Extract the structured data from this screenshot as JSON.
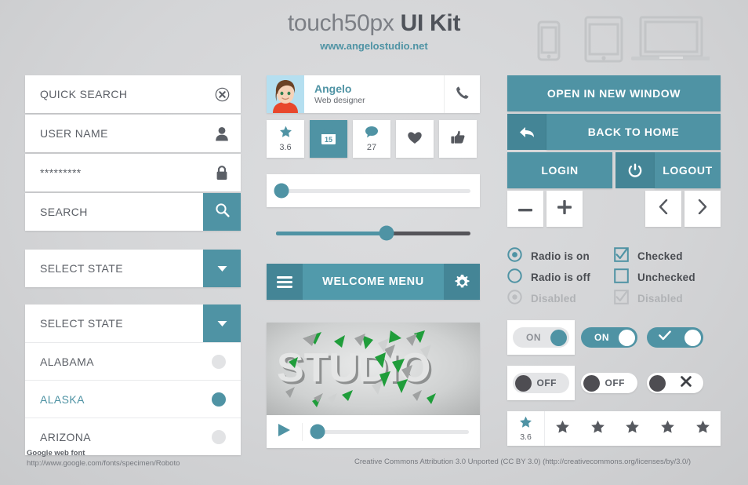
{
  "header": {
    "title_light": "touch50px ",
    "title_bold": "UI Kit",
    "subtitle": "www.angelostudio.net",
    "devices": [
      "phone-icon",
      "tablet-icon",
      "laptop-icon"
    ]
  },
  "left": {
    "quick_search": {
      "label": "QUICK SEARCH",
      "icon": "clear-circle-icon"
    },
    "user_name": {
      "label": "USER NAME",
      "icon": "user-icon"
    },
    "password": {
      "value": "*********",
      "icon": "lock-icon"
    },
    "search": {
      "label": "SEARCH",
      "icon": "search-icon"
    },
    "select_closed": {
      "label": "SELECT STATE",
      "icon": "chevron-down-icon"
    },
    "select_open": {
      "label": "SELECT STATE",
      "icon": "chevron-down-icon",
      "options": [
        {
          "label": "ALABAMA",
          "selected": false
        },
        {
          "label": "ALASKA",
          "selected": true
        },
        {
          "label": "ARIZONA",
          "selected": false
        }
      ]
    }
  },
  "middle": {
    "contact": {
      "name": "Angelo",
      "role": "Web designer",
      "avatar": "avatar",
      "phone_icon": "phone-icon"
    },
    "icon_buttons": [
      {
        "icon": "star-icon",
        "value": "3.6",
        "active": false
      },
      {
        "icon": "calendar-icon",
        "value": "15",
        "active": true
      },
      {
        "icon": "comment-icon",
        "value": "27",
        "active": false
      },
      {
        "icon": "heart-icon",
        "value": "",
        "active": false
      },
      {
        "icon": "thumbs-up-icon",
        "value": "",
        "active": false
      }
    ],
    "slider_card": {
      "value_pct": 3
    },
    "slider_bare": {
      "value_pct": 57
    },
    "menu": {
      "title": "WELCOME MENU",
      "left_icon": "hamburger-icon",
      "right_icon": "gear-icon"
    },
    "video": {
      "poster_text": "STUDIO",
      "play_icon": "play-icon",
      "progress_pct": 4
    }
  },
  "right": {
    "open_new_window": "OPEN IN NEW WINDOW",
    "back_to_home": {
      "label": "BACK TO HOME",
      "icon": "back-arrow-icon"
    },
    "login": "LOGIN",
    "logout": {
      "label": "LOGOUT",
      "icon": "power-icon"
    },
    "stepper": [
      {
        "icon": "minus-icon"
      },
      {
        "icon": "plus-icon"
      }
    ],
    "pager": [
      {
        "icon": "chevron-left-icon"
      },
      {
        "icon": "chevron-right-icon"
      }
    ],
    "choices": [
      {
        "type": "radio",
        "state": "on",
        "label": "Radio is on",
        "disabled": false
      },
      {
        "type": "checkbox",
        "state": "on",
        "label": "Checked",
        "disabled": false
      },
      {
        "type": "radio",
        "state": "off",
        "label": "Radio is off",
        "disabled": false
      },
      {
        "type": "checkbox",
        "state": "off",
        "label": "Unchecked",
        "disabled": false
      },
      {
        "type": "radio",
        "state": "on",
        "label": "Disabled",
        "disabled": true
      },
      {
        "type": "checkbox",
        "state": "on",
        "label": "Disabled",
        "disabled": true
      }
    ],
    "toggles_on": [
      {
        "style": "card-light",
        "label": "ON"
      },
      {
        "style": "teal",
        "label": "ON"
      },
      {
        "style": "teal-check",
        "label": "check-icon"
      }
    ],
    "toggles_off": [
      {
        "style": "card-light",
        "label": "OFF"
      },
      {
        "style": "white",
        "label": "OFF"
      },
      {
        "style": "white-x",
        "label": "close-x-icon"
      }
    ],
    "rating": {
      "value": "3.6",
      "star_icon": "star-icon",
      "empty_count": 5
    }
  },
  "footer": {
    "font_title": "Google web font",
    "font_url": "http://www.google.com/fonts/specimen/Roboto",
    "license": "Creative Commons Attribution 3.0 Unported (CC BY 3.0)  (http://creativecommons.org/licenses/by/3.0/)"
  },
  "colors": {
    "accent": "#4f93a4",
    "accent_dark": "#448596",
    "bg": "#d4d5d7",
    "text": "#5b5f66"
  }
}
